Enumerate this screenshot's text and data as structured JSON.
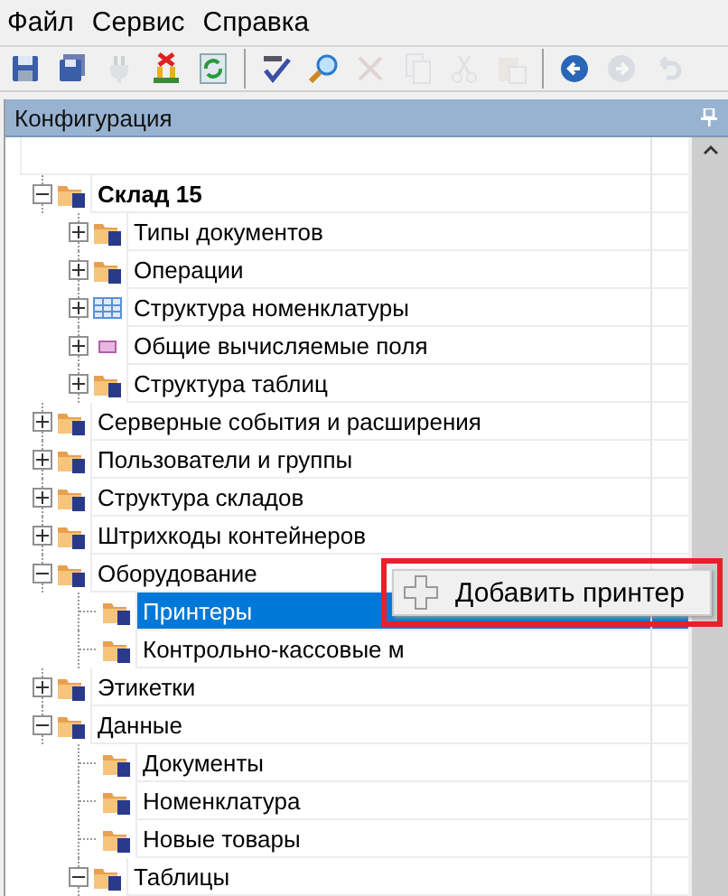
{
  "menu_bar": [
    {
      "label": "Файл"
    },
    {
      "label": "Сервис"
    },
    {
      "label": "Справка"
    }
  ],
  "toolbar": [
    {
      "kind": "save",
      "disabled": false
    },
    {
      "kind": "save-all",
      "disabled": false
    },
    {
      "kind": "plug",
      "disabled": true
    },
    {
      "kind": "delete-stack",
      "disabled": false
    },
    {
      "kind": "refresh",
      "disabled": false
    },
    {
      "kind": "separator"
    },
    {
      "kind": "spell",
      "disabled": false
    },
    {
      "kind": "search",
      "disabled": false
    },
    {
      "kind": "close",
      "disabled": true
    },
    {
      "kind": "copy",
      "disabled": true
    },
    {
      "kind": "cut",
      "disabled": true
    },
    {
      "kind": "paste",
      "disabled": true
    },
    {
      "kind": "separator"
    },
    {
      "kind": "back",
      "disabled": false
    },
    {
      "kind": "forward",
      "disabled": true
    },
    {
      "kind": "undo",
      "disabled": true
    }
  ],
  "panel": {
    "title": "Конфигурация"
  },
  "tree": [
    {
      "label": "Склад 15",
      "bold": true,
      "kind": "folder",
      "expanded": true,
      "selected": false,
      "children": [
        {
          "label": "Типы документов",
          "kind": "folder",
          "expanded": false,
          "selected": false
        },
        {
          "label": "Операции",
          "kind": "folder",
          "expanded": false,
          "selected": false
        },
        {
          "label": "Структура номенклатуры",
          "kind": "grid",
          "expanded": false,
          "selected": false
        },
        {
          "label": "Общие вычисляемые поля",
          "kind": "field",
          "expanded": false,
          "selected": false
        },
        {
          "label": "Структура таблиц",
          "kind": "folder",
          "expanded": false,
          "selected": false
        }
      ]
    },
    {
      "label": "Серверные события и расширения",
      "kind": "folder",
      "expanded": false,
      "selected": false
    },
    {
      "label": "Пользователи и группы",
      "kind": "folder",
      "expanded": false,
      "selected": false
    },
    {
      "label": "Структура складов",
      "kind": "folder",
      "expanded": false,
      "selected": false
    },
    {
      "label": "Штрихкоды контейнеров",
      "kind": "folder",
      "expanded": false,
      "selected": false
    },
    {
      "label": "Оборудование",
      "kind": "folder",
      "expanded": true,
      "selected": false,
      "children": [
        {
          "label": "Принтеры",
          "kind": "folder",
          "selected": true
        },
        {
          "label": "Контрольно-кассовые м",
          "kind": "folder",
          "selected": false
        }
      ]
    },
    {
      "label": "Этикетки",
      "kind": "folder",
      "expanded": false,
      "selected": false
    },
    {
      "label": "Данные",
      "kind": "folder",
      "expanded": true,
      "selected": false,
      "children": [
        {
          "label": "Документы",
          "kind": "folder",
          "selected": false
        },
        {
          "label": "Номенклатура",
          "kind": "folder",
          "selected": false
        },
        {
          "label": "Новые товары",
          "kind": "folder",
          "selected": false
        },
        {
          "label": "Таблицы",
          "kind": "folder",
          "expanded": true,
          "selected": false
        }
      ]
    }
  ],
  "context_menu": {
    "highlighted": true,
    "items": [
      {
        "label": "Добавить принтер"
      }
    ]
  }
}
